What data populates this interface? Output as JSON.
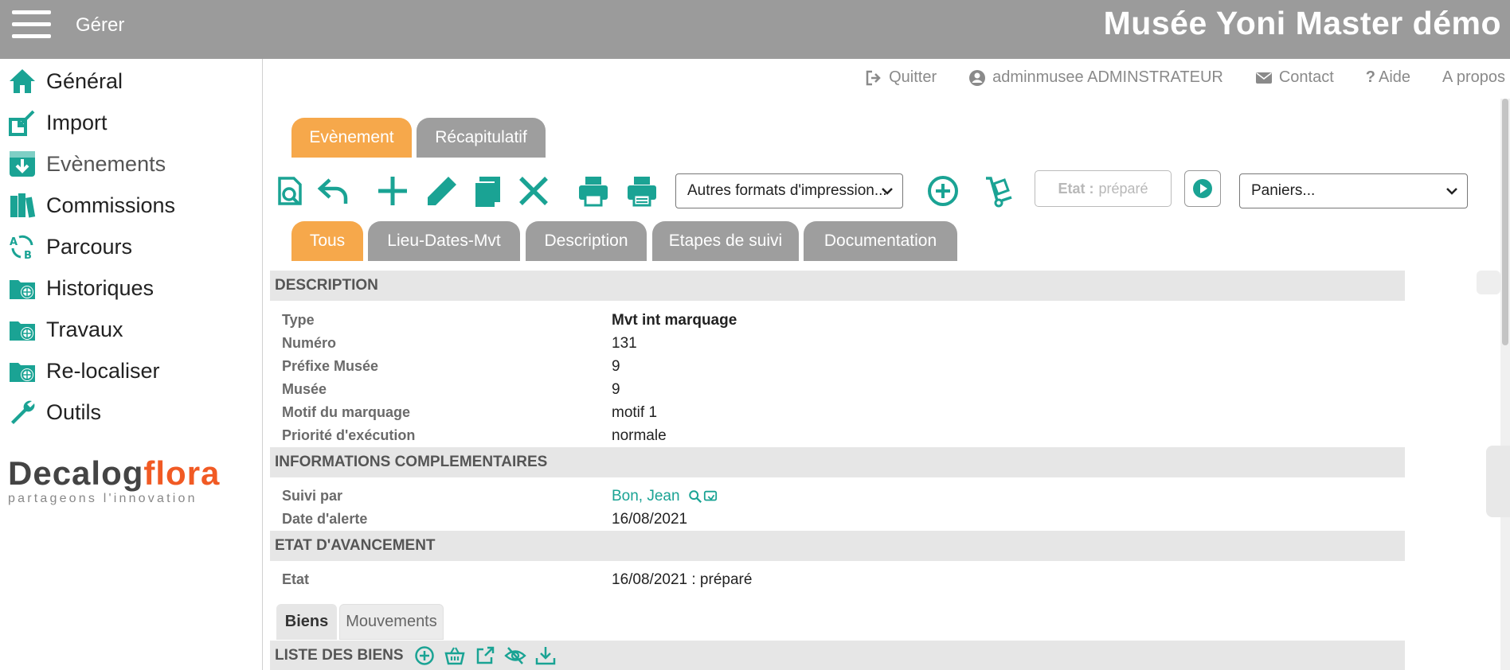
{
  "header": {
    "manage_label": "Gérer",
    "app_title": "Musée Yoni Master démo"
  },
  "sidebar": {
    "items": [
      {
        "label": "Général",
        "icon": "home-icon"
      },
      {
        "label": "Import",
        "icon": "import-icon"
      },
      {
        "label": "Evènements",
        "icon": "download-box-icon"
      },
      {
        "label": "Commissions",
        "icon": "books-icon"
      },
      {
        "label": "Parcours",
        "icon": "recycle-icon"
      },
      {
        "label": "Historiques",
        "icon": "folder-globe-icon"
      },
      {
        "label": "Travaux",
        "icon": "folder-globe-icon"
      },
      {
        "label": "Re-localiser",
        "icon": "folder-globe-icon"
      },
      {
        "label": "Outils",
        "icon": "wrench-icon"
      }
    ],
    "logo": {
      "part1": "Decalog",
      "part2": "flora",
      "tagline": "partageons l'innovation"
    }
  },
  "utility": {
    "quit": "Quitter",
    "user": "adminmusee ADMINSTRATEUR",
    "contact": "Contact",
    "help": "Aide",
    "about": "A propos"
  },
  "main_tabs": [
    {
      "label": "Evènement",
      "active": true
    },
    {
      "label": "Récapitulatif",
      "active": false
    }
  ],
  "toolbar": {
    "print_formats": "Autres formats d'impression...",
    "etat_label": "Etat :",
    "etat_value": "préparé",
    "baskets": "Paniers..."
  },
  "section_tabs": [
    {
      "label": "Tous",
      "active": true
    },
    {
      "label": "Lieu-Dates-Mvt",
      "active": false
    },
    {
      "label": "Description",
      "active": false
    },
    {
      "label": "Etapes de suivi",
      "active": false
    },
    {
      "label": "Documentation",
      "active": false
    }
  ],
  "description": {
    "title": "DESCRIPTION",
    "rows": [
      {
        "label": "Type",
        "value": "Mvt int marquage"
      },
      {
        "label": "Numéro",
        "value": "131"
      },
      {
        "label": "Préfixe Musée",
        "value": "9"
      },
      {
        "label": "Musée",
        "value": "9"
      },
      {
        "label": "Motif du marquage",
        "value": "motif 1"
      },
      {
        "label": "Priorité d'exécution",
        "value": "normale"
      }
    ]
  },
  "complementary": {
    "title": "INFORMATIONS COMPLEMENTAIRES",
    "rows": [
      {
        "label": "Suivi par",
        "value": "Bon, Jean"
      },
      {
        "label": "Date d'alerte",
        "value": "16/08/2021"
      }
    ]
  },
  "progress": {
    "title": "ETAT D'AVANCEMENT",
    "rows": [
      {
        "label": "Etat",
        "value": "16/08/2021 : préparé"
      }
    ]
  },
  "sub_tabs": [
    {
      "label": "Biens",
      "active": true
    },
    {
      "label": "Mouvements",
      "active": false
    }
  ],
  "list": {
    "title": "LISTE DES BIENS"
  },
  "colors": {
    "accent_green": "#1aa394",
    "tab_orange": "#f6a84b",
    "header_grey": "#9b9b9b"
  }
}
